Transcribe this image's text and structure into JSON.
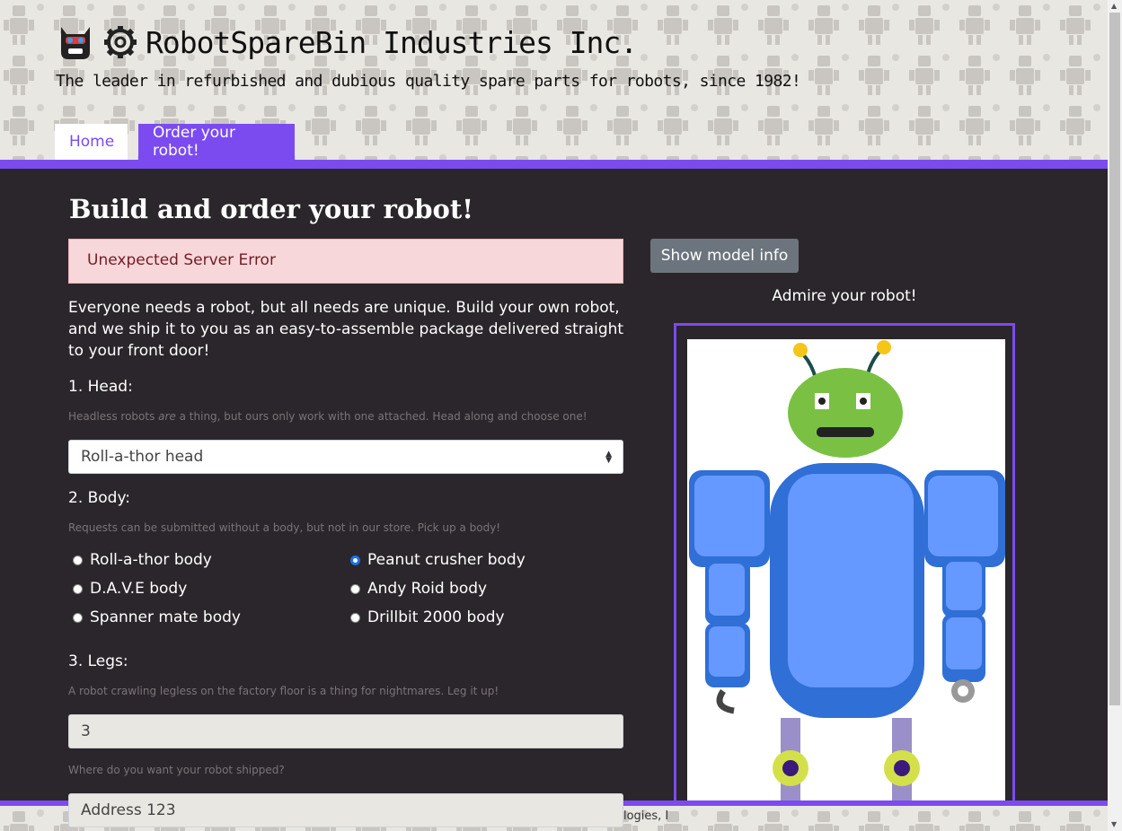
{
  "brand": {
    "title": "RobotSpareBin Industries Inc.",
    "tagline": "The leader in refurbished and dubious quality spare parts for robots, since 1982!"
  },
  "nav": {
    "tabs": [
      {
        "label": "Home"
      },
      {
        "label": "Order your robot!"
      }
    ]
  },
  "form": {
    "heading": "Build and order your robot!",
    "error": "Unexpected Server Error",
    "intro": "Everyone needs a robot, but all needs are unique. Build your own robot, and we ship it to you as an easy-to-assemble package delivered straight to your front door!",
    "head": {
      "label": "1. Head:",
      "help_before": "Headless robots ",
      "help_em": "are",
      "help_after": " a thing, but ours only work with one attached. Head along and choose one!",
      "selected": "Roll-a-thor head"
    },
    "body": {
      "label": "2. Body:",
      "help": "Requests can be submitted without a body, but not in our store. Pick up a body!",
      "options": [
        {
          "label": "Roll-a-thor body",
          "checked": false
        },
        {
          "label": "Peanut crusher body",
          "checked": true
        },
        {
          "label": "D.A.V.E body",
          "checked": false
        },
        {
          "label": "Andy Roid body",
          "checked": false
        },
        {
          "label": "Spanner mate body",
          "checked": false
        },
        {
          "label": "Drillbit 2000 body",
          "checked": false
        }
      ]
    },
    "legs": {
      "label": "3. Legs:",
      "help": "A robot crawling legless on the factory floor is a thing for nightmares. Leg it up!",
      "value": "3"
    },
    "address": {
      "help": "Where do you want your robot shipped?",
      "value": "Address 123"
    }
  },
  "preview": {
    "button": "Show model info",
    "caption": "Admire your robot!"
  },
  "footer": {
    "text": "ologies, I"
  },
  "colors": {
    "accent": "#7b4bf0",
    "background": "#2b262b",
    "error_bg": "#f8d7da",
    "error_text": "#721c24"
  },
  "icons": [
    "robot-logo-icon",
    "gear-logo-icon"
  ]
}
